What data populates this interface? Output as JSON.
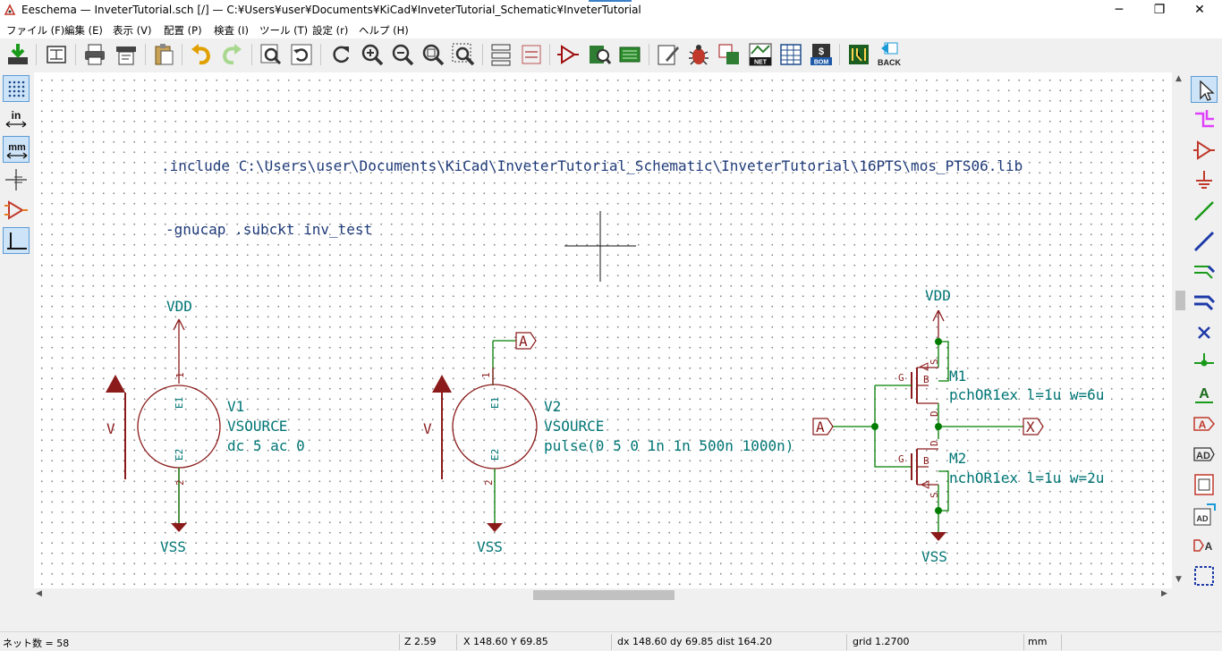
{
  "window": {
    "title": "Eeschema — InveterTutorial.sch [/] — C:¥Users¥user¥Documents¥KiCad¥InveterTutorial_Schematic¥InveterTutorial",
    "minimize": "─",
    "restore": "❐",
    "close": "✕"
  },
  "menu": {
    "items": [
      "ファイル (F)",
      "編集 (E)",
      "表示 (V)",
      "配置 (P)",
      "検査 (I)",
      "ツール (T)",
      "設定 (r)",
      "ヘルプ (H)"
    ]
  },
  "toolbar": {
    "back_label": "BACK",
    "net_label": "NET",
    "bom_label": "BOM"
  },
  "left_toolbar": {
    "in_label": "in",
    "mm_label": "mm"
  },
  "schematic": {
    "include_text": ".include C:\\Users\\user\\Documents\\KiCad\\InveterTutorial_Schematic\\InveterTutorial\\16PTS\\mos_PTS06.lib",
    "gnucap_text": "-gnucap .subckt inv_test",
    "v1": {
      "ref": "V1",
      "value": "VSOURCE",
      "params": "dc 5 ac 0",
      "top_net": "VDD",
      "bottom_net": "VSS",
      "arrow_label": "V",
      "pin1": "1",
      "pin2": "2",
      "e1": "E1",
      "e2": "E2"
    },
    "v2": {
      "ref": "V2",
      "value": "VSOURCE",
      "params": "pulse(0 5 0 1n 1n 500n 1000n)",
      "top_label": "A",
      "bottom_net": "VSS",
      "arrow_label": "V",
      "pin1": "1",
      "pin2": "2",
      "e1": "E1",
      "e2": "E2"
    },
    "m1": {
      "ref": "M1",
      "value": "pchOR1ex l=1u w=6u",
      "top_net": "VDD",
      "pin_g": "G",
      "pin_b": "B",
      "pin_s": "S",
      "pin_d": "D"
    },
    "m2": {
      "ref": "M2",
      "value": "nchOR1ex l=1u w=2u",
      "bottom_net": "VSS",
      "pin_g": "G",
      "pin_b": "B",
      "pin_s": "S",
      "pin_d": "D"
    },
    "input_label": "A",
    "output_label": "X"
  },
  "status": {
    "nets": "ネット数 = 58",
    "zoom": "Z 2.59",
    "xy": "X 148.60  Y 69.85",
    "delta": "dx 148.60  dy 69.85  dist 164.20",
    "grid": "grid 1.2700",
    "units": "mm"
  },
  "colors": {
    "wire": "#007d00",
    "component": "#8b1a1a",
    "net_text": "#007575",
    "comment": "#1e3a78",
    "junction": "#007d00"
  }
}
